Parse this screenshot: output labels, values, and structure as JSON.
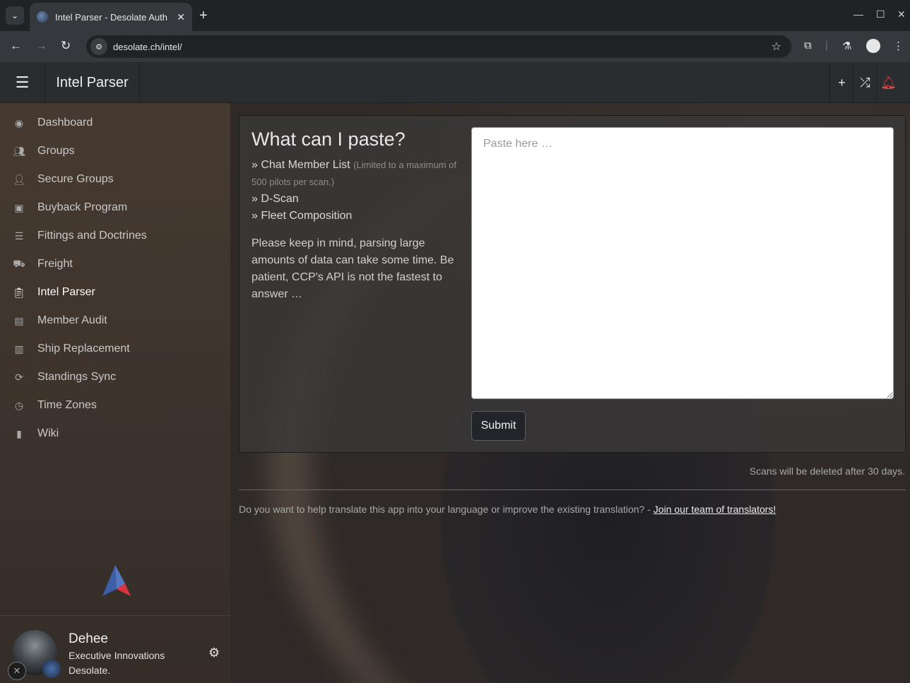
{
  "browser": {
    "tab_title": "Intel Parser - Desolate Auth",
    "url": "desolate.ch/intel/"
  },
  "navbar": {
    "title": "Intel Parser"
  },
  "sidebar": {
    "items": [
      {
        "label": "Dashboard",
        "icon": "dashboard-icon"
      },
      {
        "label": "Groups",
        "icon": "users-icon"
      },
      {
        "label": "Secure Groups",
        "icon": "user-lock-icon"
      },
      {
        "label": "Buyback Program",
        "icon": "store-icon"
      },
      {
        "label": "Fittings and Doctrines",
        "icon": "list-icon"
      },
      {
        "label": "Freight",
        "icon": "truck-icon"
      },
      {
        "label": "Intel Parser",
        "icon": "clipboard-icon",
        "active": true
      },
      {
        "label": "Member Audit",
        "icon": "id-card-icon"
      },
      {
        "label": "Ship Replacement",
        "icon": "money-icon"
      },
      {
        "label": "Standings Sync",
        "icon": "sync-icon"
      },
      {
        "label": "Time Zones",
        "icon": "clock-icon"
      },
      {
        "label": "Wiki",
        "icon": "book-icon"
      }
    ]
  },
  "user": {
    "name": "Dehee",
    "corporation": "Executive Innovations",
    "alliance": "Desolate."
  },
  "help": {
    "title": "What can I paste?",
    "item1": "» Chat Member List",
    "item1_note": "(Limited to a maximum of 500 pilots per scan.)",
    "item2": "» D-Scan",
    "item3": "» Fleet Composition",
    "paragraph": "Please keep in mind, parsing large amounts of data can take some time. Be patient, CCP's API is not the fastest to answer …"
  },
  "form": {
    "placeholder": "Paste here …",
    "submit_label": "Submit"
  },
  "scan_note": "Scans will be deleted after 30 days.",
  "footer": {
    "text": "Do you want to help translate this app into your language or improve the existing translation? - ",
    "link": "Join our team of translators!"
  },
  "colors": {
    "bell": "#e04a4a",
    "logo_blue": "#3d5fa8",
    "logo_red": "#d9343f"
  }
}
